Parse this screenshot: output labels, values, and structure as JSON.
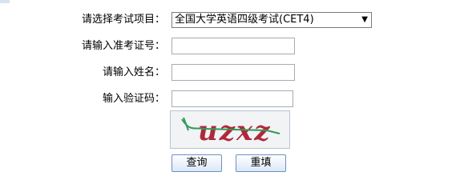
{
  "form": {
    "exam_label": "请选择考试项目：",
    "exam_selected": "全国大学英语四级考试(CET4)",
    "ticket_label": "请输入准考证号：",
    "ticket_value": "",
    "name_label": "请输入姓名：",
    "name_value": "",
    "captcha_label": "输入验证码：",
    "captcha_value": "",
    "captcha_text": "uzxz",
    "query_button": "查询",
    "reset_button": "重填"
  },
  "colors": {
    "captcha_text": "#b0283a",
    "captcha_line": "#2f9a57"
  }
}
